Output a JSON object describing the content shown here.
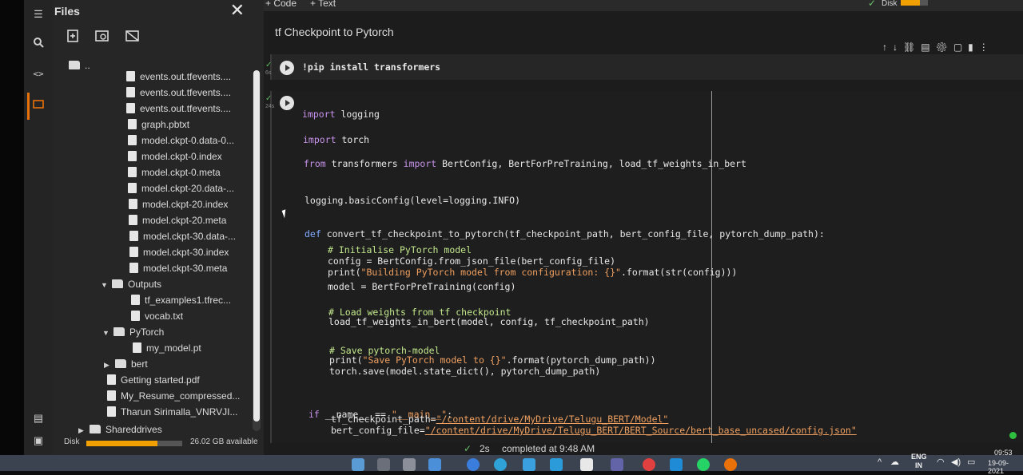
{
  "files_panel": {
    "title": "Files",
    "close": "✕",
    "tree": [
      {
        "type": "folder-up",
        "label": ".."
      },
      {
        "type": "file",
        "label": "events.out.tfevents...."
      },
      {
        "type": "file",
        "label": "events.out.tfevents...."
      },
      {
        "type": "file",
        "label": "events.out.tfevents...."
      },
      {
        "type": "file",
        "label": "graph.pbtxt"
      },
      {
        "type": "file",
        "label": "model.ckpt-0.data-0..."
      },
      {
        "type": "file",
        "label": "model.ckpt-0.index"
      },
      {
        "type": "file",
        "label": "model.ckpt-0.meta"
      },
      {
        "type": "file",
        "label": "model.ckpt-20.data-..."
      },
      {
        "type": "file",
        "label": "model.ckpt-20.index"
      },
      {
        "type": "file",
        "label": "model.ckpt-20.meta"
      },
      {
        "type": "file",
        "label": "model.ckpt-30.data-..."
      },
      {
        "type": "file",
        "label": "model.ckpt-30.index"
      },
      {
        "type": "file",
        "label": "model.ckpt-30.meta"
      },
      {
        "type": "folder-open",
        "label": "Outputs"
      },
      {
        "type": "file",
        "label": "tf_examples1.tfrec..."
      },
      {
        "type": "file",
        "label": "vocab.txt"
      },
      {
        "type": "folder-open",
        "label": "PyTorch"
      },
      {
        "type": "file",
        "label": "my_model.pt"
      },
      {
        "type": "folder-closed",
        "label": "bert"
      },
      {
        "type": "file",
        "label": "Getting started.pdf"
      },
      {
        "type": "file",
        "label": "My_Resume_compressed..."
      },
      {
        "type": "file",
        "label": "Tharun Sirimalla_VNRVJI..."
      },
      {
        "type": "folder-closed",
        "label": "Shareddrives"
      }
    ],
    "disk_label": "Disk",
    "disk_fill": 0.74,
    "disk_available": "26.02 GB available"
  },
  "toolbar": {
    "add_code": "+ Code",
    "add_text": "+ Text",
    "disk": "Disk"
  },
  "notebook": {
    "title": "tf Checkpoint to Pytorch",
    "cell1": {
      "code": "!pip install transformers",
      "time": "6s"
    },
    "cell2": {
      "time": "24s"
    }
  },
  "status": {
    "check": "✓",
    "duration": "2s",
    "completed": "completed at 9:48 AM"
  },
  "taskbar": {
    "lang1": "ENG",
    "lang2": "IN",
    "time": "09:53",
    "date": "19-09-2021"
  },
  "colors": {
    "accent": "#e8710a",
    "disk_fill": "#f0a000",
    "keyword": "#c792ea",
    "comment": "#c3e88d",
    "string": "#f0a060"
  }
}
